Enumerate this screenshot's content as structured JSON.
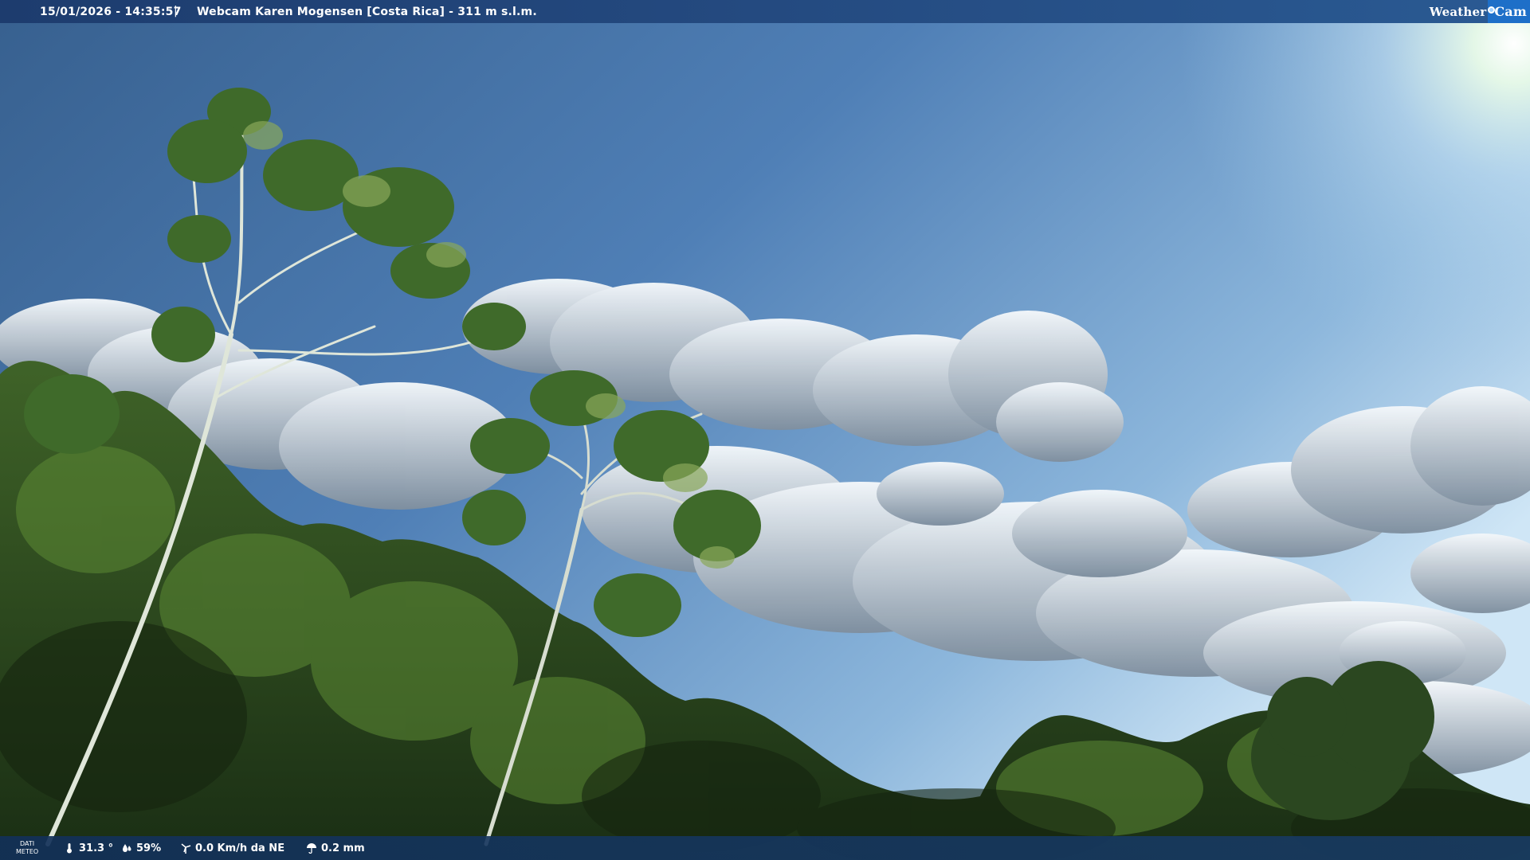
{
  "header": {
    "timestamp": "15/01/2026 - 14:35:57",
    "separator": "|",
    "title": "Webcam Karen Mogensen [Costa Rica] - 311 m s.l.m."
  },
  "logo": {
    "word_weather": "Weather",
    "word_cam": "Cam"
  },
  "footer": {
    "label_line1": "DATI",
    "label_line2": "METEO",
    "temperature": "31.3 °",
    "humidity": "59%",
    "wind": "0.0 Km/h da NE",
    "rain": "0.2 mm"
  },
  "colors": {
    "sky_top": "#3a6398",
    "sky_mid": "#6f9dc9",
    "sun_glow": "#e9f8ff",
    "foliage_dark": "#1f3518",
    "foliage_light": "#5f8a3a",
    "bar_blue": "#1d3c6e",
    "logo_blue": "#1e6fc8"
  }
}
